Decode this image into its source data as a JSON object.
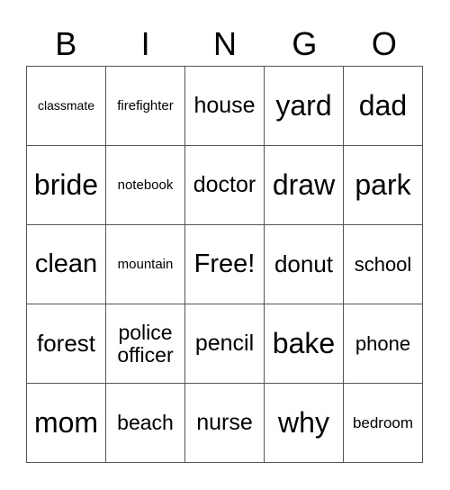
{
  "header": [
    "B",
    "I",
    "N",
    "G",
    "O"
  ],
  "rows": [
    [
      {
        "t": "classmate",
        "s": 14
      },
      {
        "t": "firefighter",
        "s": 15
      },
      {
        "t": "house",
        "s": 25
      },
      {
        "t": "yard",
        "s": 32
      },
      {
        "t": "dad",
        "s": 32
      }
    ],
    [
      {
        "t": "bride",
        "s": 32
      },
      {
        "t": "notebook",
        "s": 15
      },
      {
        "t": "doctor",
        "s": 25
      },
      {
        "t": "draw",
        "s": 32
      },
      {
        "t": "park",
        "s": 32
      }
    ],
    [
      {
        "t": "clean",
        "s": 29
      },
      {
        "t": "mountain",
        "s": 15
      },
      {
        "t": "Free!",
        "s": 29
      },
      {
        "t": "donut",
        "s": 26
      },
      {
        "t": "school",
        "s": 22
      }
    ],
    [
      {
        "t": "forest",
        "s": 26
      },
      {
        "t": "police officer",
        "s": 23
      },
      {
        "t": "pencil",
        "s": 25
      },
      {
        "t": "bake",
        "s": 32
      },
      {
        "t": "phone",
        "s": 22
      }
    ],
    [
      {
        "t": "mom",
        "s": 32
      },
      {
        "t": "beach",
        "s": 23
      },
      {
        "t": "nurse",
        "s": 25
      },
      {
        "t": "why",
        "s": 32
      },
      {
        "t": "bedroom",
        "s": 17
      }
    ]
  ]
}
